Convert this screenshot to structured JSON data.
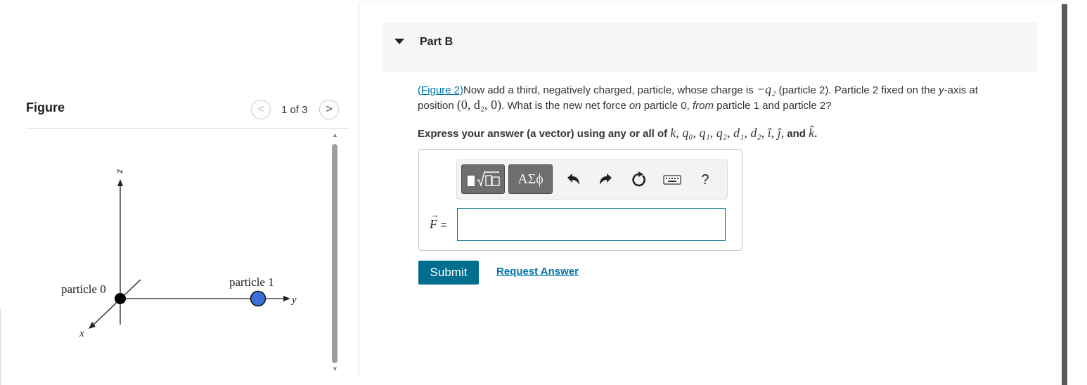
{
  "figure_panel": {
    "title": "Figure",
    "pager": "1 of 3",
    "prev_glyph": "<",
    "next_glyph": ">",
    "scroll_up_glyph": "▲",
    "scroll_down_glyph": "▼",
    "diagram": {
      "axis_z": "z",
      "axis_x": "x",
      "axis_y": "y",
      "particle0_label": "particle 0",
      "particle1_label": "particle 1"
    }
  },
  "part": {
    "title": "Part B",
    "question": {
      "figure_link": "(Figure 2)",
      "text1": "Now add a third, negatively charged, particle, whose charge is ",
      "charge": "−q₂",
      "text2": " (particle 2). Particle 2 fixed on the ",
      "y_axis": "y",
      "text3": "-axis at",
      "text4": "position ",
      "position": "(0, d₂, 0)",
      "text5": ". What is the new net force ",
      "on": "on",
      "text6": " particle 0, ",
      "from": "from",
      "text7": " particle 1 and particle 2?"
    },
    "instruction": {
      "text1": "Express your answer (a vector) using any or all of ",
      "vars": "k, q₀, q₁, q₂, d₁, d₂, î, ĵ,",
      "text2": " and ",
      "last": "k̂",
      "text3": "."
    },
    "answer": {
      "label": "F",
      "equals": "=",
      "value": ""
    },
    "toolbar": {
      "symbols_label": "ΑΣϕ",
      "help_label": "?",
      "icons": [
        "templates-icon",
        "undo-icon",
        "redo-icon",
        "reset-icon",
        "keyboard-icon",
        "help-icon"
      ]
    },
    "submit_label": "Submit",
    "request_label": "Request Answer"
  },
  "colors": {
    "accent": "#006e8f",
    "link": "#0074a8",
    "particle1": "#3a6fd8",
    "particle0": "#000000"
  }
}
